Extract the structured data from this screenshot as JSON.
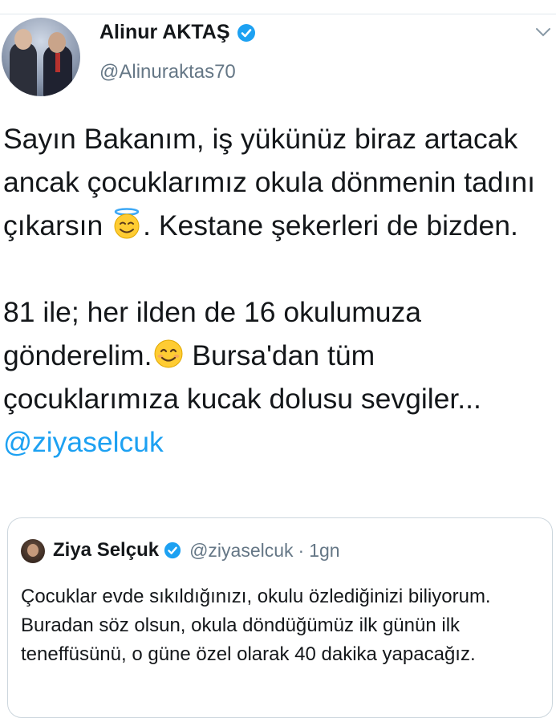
{
  "tweet": {
    "author_name": "Alinur AKTAŞ",
    "author_handle": "@Alinuraktas70",
    "text_part1": "Sayın Bakanım, iş yükünüz biraz artacak ancak çocuklarımız okula dönmenin tadını çıkarsın ",
    "text_part2": ". Kestane şekerleri de bizden.\n\n81 ile; her ilden de 16 okulumuza gönderelim.",
    "text_part3": " Bursa'dan tüm çocuklarımıza kucak dolusu sevgiler... ",
    "mention": "@ziyaselcuk"
  },
  "quoted": {
    "author_name": "Ziya Selçuk",
    "author_handle": "@ziyaselcuk",
    "separator": "·",
    "time": "1gn",
    "text": "Çocuklar evde sıkıldığınızı, okulu özlediğinizi biliyorum. Buradan söz olsun, okula döndüğümüz ilk günün ilk teneffüsünü, o güne özel olarak 40 dakika yapacağız."
  },
  "icons": {
    "verified": "verified-badge-icon",
    "caret": "chevron-down-icon",
    "emoji1": "smiling-face-with-halo",
    "emoji2": "smiling-face-with-smiling-eyes"
  },
  "colors": {
    "link": "#1da1f2",
    "secondary_text": "#657786",
    "verified": "#1da1f2"
  }
}
